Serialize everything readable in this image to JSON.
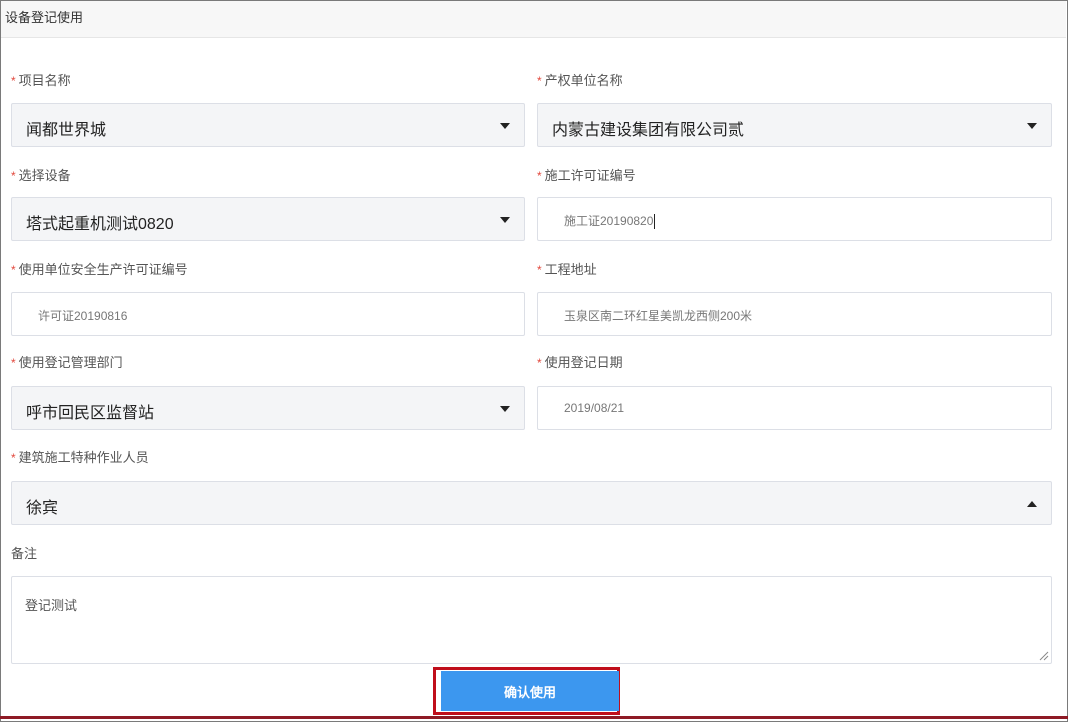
{
  "title": "设备登记使用",
  "fields": {
    "project_name": {
      "label": "项目名称",
      "value": "闻都世界城"
    },
    "owner_unit": {
      "label": "产权单位名称",
      "value": "内蒙古建设集团有限公司贰"
    },
    "device": {
      "label": "选择设备",
      "value": "塔式起重机测试0820"
    },
    "construction_permit": {
      "label": "施工许可证编号",
      "value": "施工证20190820"
    },
    "safety_license": {
      "label": "使用单位安全生产许可证编号",
      "value": "许可证20190816"
    },
    "project_address": {
      "label": "工程地址",
      "value": "玉泉区南二环红星美凯龙西侧200米"
    },
    "registration_dept": {
      "label": "使用登记管理部门",
      "value": "呼市回民区监督站"
    },
    "registration_date": {
      "label": "使用登记日期",
      "value": "2019/08/21"
    },
    "special_workers": {
      "label": "建筑施工特种作业人员",
      "value": "徐宾"
    },
    "remarks": {
      "label": "备注",
      "value": "登记测试"
    }
  },
  "required_mark": "*",
  "confirm_button": "确认使用",
  "colors": {
    "accent": "#3c97ef",
    "required": "#e2483d",
    "highlight": "#c00e1b"
  }
}
